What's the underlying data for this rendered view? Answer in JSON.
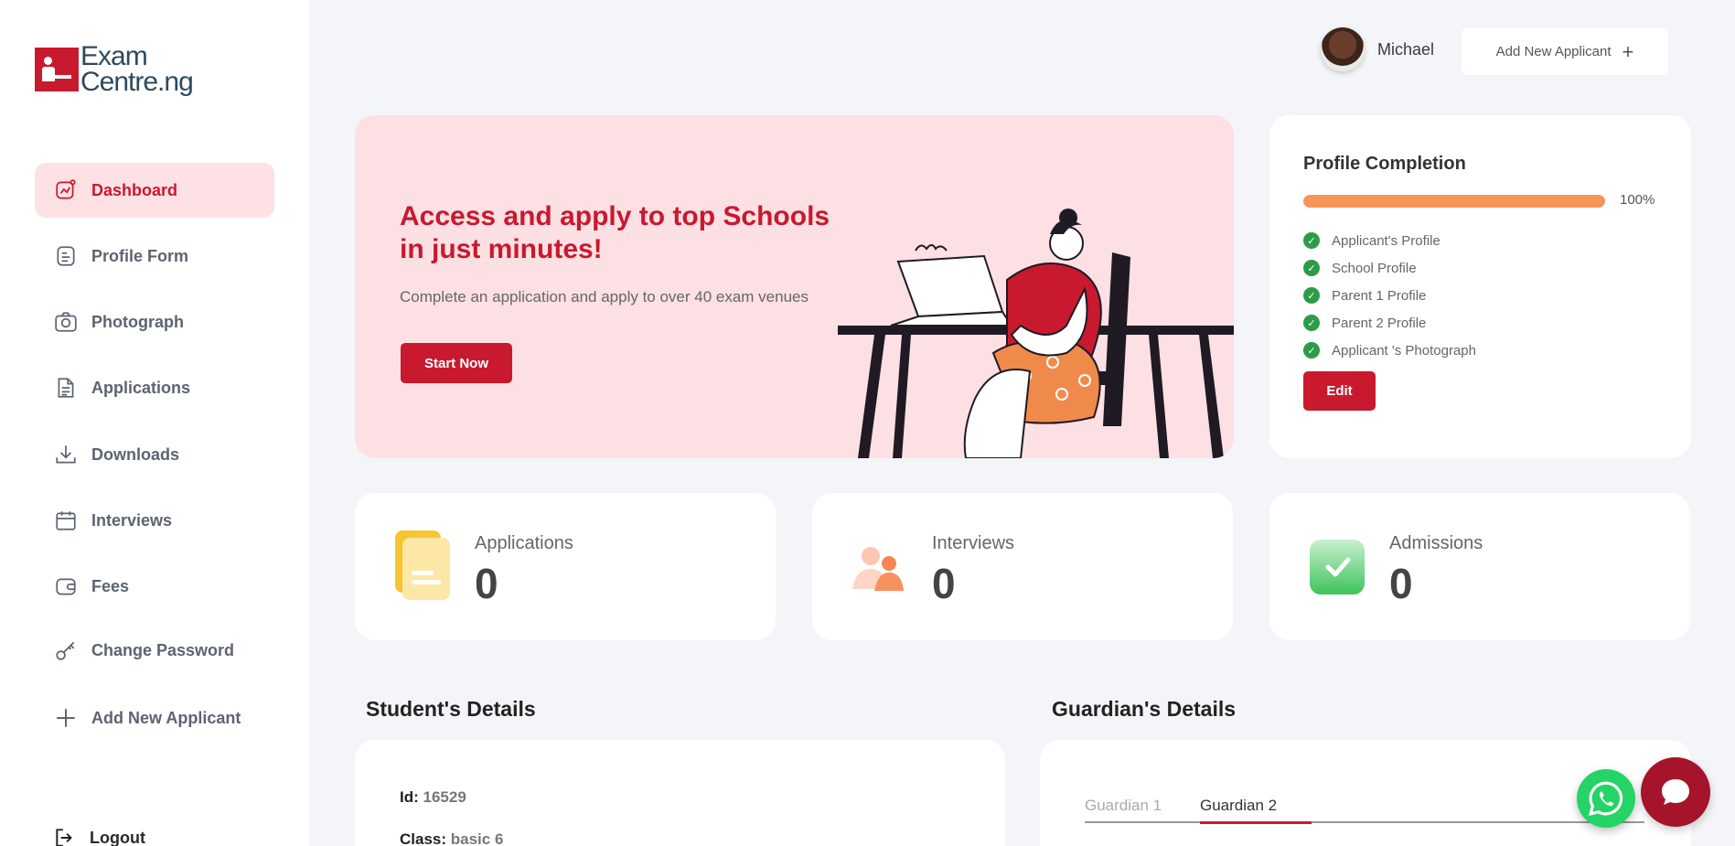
{
  "brand": {
    "line1": "Exam",
    "line2": "Centre.ng",
    "color": "#c8192f"
  },
  "sidebar": {
    "items": [
      {
        "label": "Dashboard",
        "icon": "chart-icon",
        "active": true
      },
      {
        "label": "Profile Form",
        "icon": "form-icon"
      },
      {
        "label": "Photograph",
        "icon": "camera-icon"
      },
      {
        "label": "Applications",
        "icon": "document-icon"
      },
      {
        "label": "Downloads",
        "icon": "download-icon"
      },
      {
        "label": "Interviews",
        "icon": "calendar-icon"
      },
      {
        "label": "Fees",
        "icon": "wallet-icon"
      },
      {
        "label": "Change Password",
        "icon": "key-icon"
      },
      {
        "label": "Add New Applicant",
        "icon": "plus-icon"
      }
    ],
    "logout": "Logout"
  },
  "header": {
    "user_name": "Michael",
    "add_button": "Add New Applicant"
  },
  "hero": {
    "title": "Access and apply to top Schools in just minutes!",
    "subtitle": "Complete an application and apply to over 40 exam venues",
    "button": "Start Now"
  },
  "profile": {
    "title": "Profile Completion",
    "progress_percent": 100,
    "progress_label": "100%",
    "checks": [
      "Applicant's Profile",
      "School Profile",
      "Parent 1 Profile",
      "Parent 2 Profile",
      "Applicant 's Photograph"
    ],
    "edit_button": "Edit",
    "progress_color": "#f7945a"
  },
  "stats": [
    {
      "label": "Applications",
      "value": "0",
      "icon": "applications-icon"
    },
    {
      "label": "Interviews",
      "value": "0",
      "icon": "interviews-icon"
    },
    {
      "label": "Admissions",
      "value": "0",
      "icon": "admissions-icon"
    }
  ],
  "student": {
    "title": "Student's Details",
    "id_label": "Id:",
    "id_value": "16529",
    "class_label": "Class:",
    "class_value": "basic 6"
  },
  "guardian": {
    "title": "Guardian's Details",
    "tabs": [
      "Guardian 1",
      "Guardian 2"
    ],
    "active_tab": "Guardian 2"
  }
}
